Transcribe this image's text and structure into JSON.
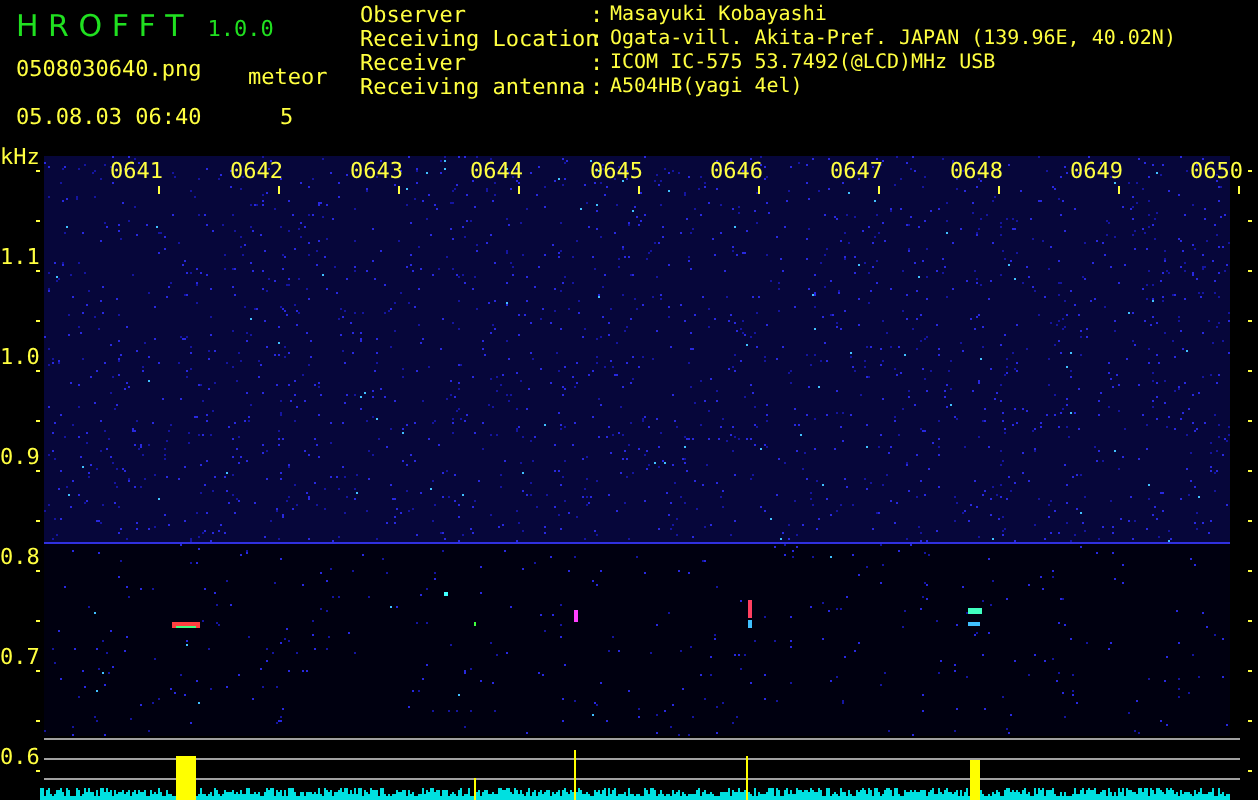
{
  "app": {
    "name": "H R O F F T",
    "version": "1.0.0"
  },
  "file": {
    "filename": "0508030640.png",
    "datetime": "05.08.03 06:40"
  },
  "meteor": {
    "label": "meteor",
    "count": "5"
  },
  "info": [
    {
      "label": "Observer",
      "separator": ":",
      "value": "Masayuki Kobayashi"
    },
    {
      "label": "Receiving Location",
      "separator": ":",
      "value": "Ogata-vill. Akita-Pref. JAPAN (139.96E, 40.02N)"
    },
    {
      "label": "Receiver",
      "separator": ":",
      "value": "ICOM IC-575 53.7492(@LCD)MHz USB"
    },
    {
      "label": "Receiving antenna",
      "separator": ":",
      "value": "A504HB(yagi 4el)"
    }
  ],
  "spectrogram": {
    "y_unit": "kHz",
    "y_labels": [
      "1.1",
      "1.0",
      "0.9",
      "0.8",
      "0.7",
      "0.6"
    ],
    "time_labels": [
      "0641",
      "0642",
      "0643",
      "0644",
      "0645",
      "0646",
      "0647",
      "0648",
      "0649",
      "0650"
    ]
  }
}
